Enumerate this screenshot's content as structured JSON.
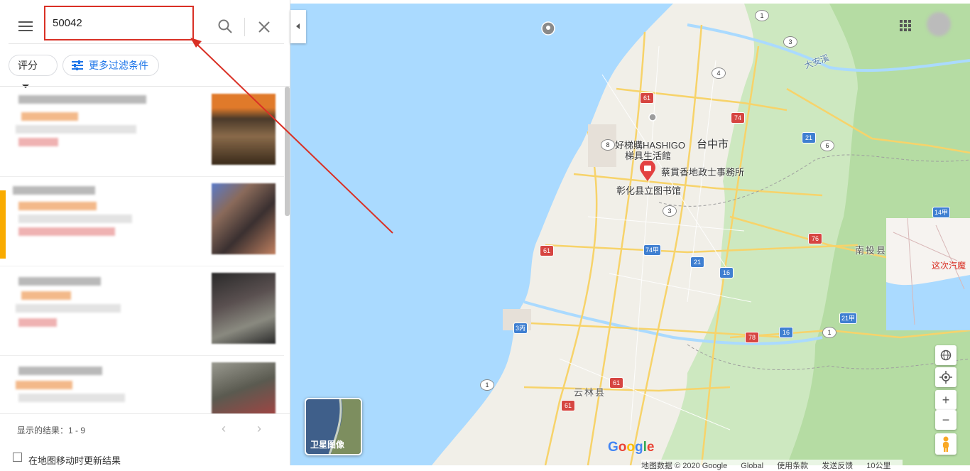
{
  "search": {
    "query": "50042"
  },
  "filters": {
    "rating_label": "评分",
    "more_filters_label": "更多过滤条件"
  },
  "footer": {
    "results_text": "显示的结果：1 - 9",
    "update_on_move_label": "在地图移动时更新结果"
  },
  "map": {
    "labels": {
      "taichung": "台中市",
      "hashigo_line1": "好梯購HASHIGO",
      "hashigo_line2": "梯具生活館",
      "cai_office": "蔡貫香地政士事務所",
      "changhua_library": "彰化县立图书馆",
      "yunlin": "云林县",
      "nantou": "南投县",
      "daan_river": "大安溪"
    },
    "route_shields": [
      "1",
      "3",
      "4",
      "61",
      "74",
      "8",
      "21",
      "6",
      "76",
      "74甲",
      "3",
      "14甲",
      "61",
      "16",
      "21甲",
      "21",
      "3丙",
      "16",
      "1",
      "78",
      "61",
      "61",
      "1"
    ],
    "satellite_label": "卫星图像",
    "minimap_text": "这次汽魔",
    "google_logo": "Google",
    "attribution": [
      "地图数据 © 2020 Google",
      "Global",
      "使用条款",
      "发送反馈",
      "10公里"
    ]
  },
  "colors": {
    "accent_blue": "#1a73e8",
    "highlight_red": "#d93025",
    "selection_bar": "#f9ab00",
    "water": "#aadaff"
  }
}
